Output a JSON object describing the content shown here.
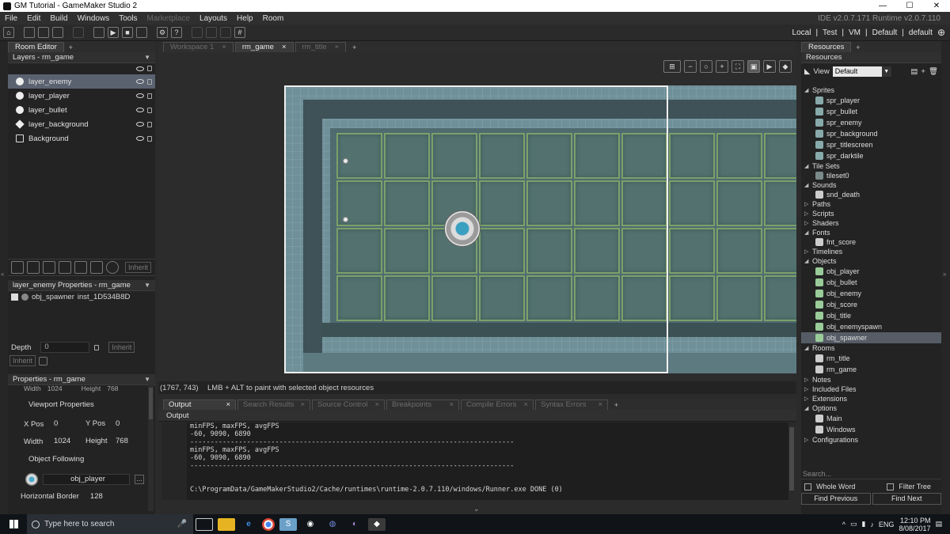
{
  "window": {
    "title": "GM Tutorial - GameMaker Studio 2",
    "version": "IDE v2.0.7.171 Runtime v2.0.7.110"
  },
  "menu": [
    "File",
    "Edit",
    "Build",
    "Windows",
    "Tools",
    "Marketplace",
    "Layouts",
    "Help",
    "Room"
  ],
  "targets": {
    "local": "Local",
    "test": "Test",
    "vm": "VM",
    "default1": "Default",
    "default2": "default"
  },
  "left": {
    "tab": "Room Editor",
    "layers_header": "Layers - rm_game",
    "layers": [
      "layer_enemy",
      "layer_player",
      "layer_bullet",
      "layer_background",
      "Background"
    ],
    "inherit": "Inherit",
    "props_header": "layer_enemy Properties - rm_game",
    "instance": {
      "object": "obj_spawner",
      "id": "inst_1D534B8D"
    },
    "depth_label": "Depth",
    "depth_value": "0",
    "props2_header": "Properties - rm_game",
    "width_label": "Width",
    "width_value": "1024",
    "height_label": "Height",
    "height_value": "768",
    "viewport_header": "Viewport Properties",
    "xpos_label": "X Pos",
    "xpos_value": "0",
    "ypos_label": "Y Pos",
    "ypos_value": "0",
    "vw_label": "Width",
    "vw_value": "1024",
    "vh_label": "Height",
    "vh_value": "768",
    "follow_header": "Object Following",
    "follow_object": "obj_player",
    "hborder_label": "Horizontal Border",
    "hborder_value": "128"
  },
  "center": {
    "tabs": [
      "Workspace 1",
      "rm_game",
      "rm_title"
    ],
    "status_coords": "(1767, 743)",
    "status_hint": "LMB + ALT to paint with selected object resources"
  },
  "output": {
    "tabs": [
      "Output",
      "Search Results",
      "Source Control",
      "Breakpoints",
      "Compile Errors",
      "Syntax Errors"
    ],
    "header": "Output",
    "lines": [
      "minFPS, maxFPS, avgFPS",
      "-60, 9090, 6890",
      "--------------------------------------------------------------------------------",
      "minFPS, maxFPS, avgFPS",
      "-60, 9090, 6890",
      "--------------------------------------------------------------------------------",
      "",
      "",
      "C:\\ProgramData/GameMakerStudio2/Cache/runtimes\\runtime-2.0.7.110/windows/Runner.exe DONE (0)"
    ]
  },
  "resources": {
    "tab": "Resources",
    "header": "Resources",
    "view_label": "View",
    "view_value": "Default",
    "tree": [
      {
        "g": "Sprites",
        "items": [
          "spr_player",
          "spr_bullet",
          "spr_enemy",
          "spr_background",
          "spr_titlescreen",
          "spr_darktile"
        ]
      },
      {
        "g": "Tile Sets",
        "items": [
          "tileset0"
        ]
      },
      {
        "g": "Sounds",
        "items": [
          "snd_death"
        ]
      },
      {
        "g": "Paths",
        "items": []
      },
      {
        "g": "Scripts",
        "items": []
      },
      {
        "g": "Shaders",
        "items": []
      },
      {
        "g": "Fonts",
        "items": [
          "fnt_score"
        ]
      },
      {
        "g": "Timelines",
        "items": []
      },
      {
        "g": "Objects",
        "items": [
          "obj_player",
          "obj_bullet",
          "obj_enemy",
          "obj_score",
          "obj_title",
          "obj_enemyspawn",
          "obj_spawner"
        ]
      },
      {
        "g": "Rooms",
        "items": [
          "rm_title",
          "rm_game"
        ]
      },
      {
        "g": "Notes",
        "items": []
      },
      {
        "g": "Included Files",
        "items": []
      },
      {
        "g": "Extensions",
        "items": []
      },
      {
        "g": "Options",
        "items": [
          "Main",
          "Windows"
        ]
      },
      {
        "g": "Configurations",
        "items": []
      }
    ],
    "selected": "obj_spawner",
    "search_placeholder": "Search...",
    "whole_word": "Whole Word",
    "filter_tree": "Filter Tree",
    "find_previous": "Find Previous",
    "find_next": "Find Next"
  },
  "taskbar": {
    "search_placeholder": "Type here to search",
    "lang": "ENG",
    "time": "12:10 PM",
    "date": "8/08/2017"
  }
}
